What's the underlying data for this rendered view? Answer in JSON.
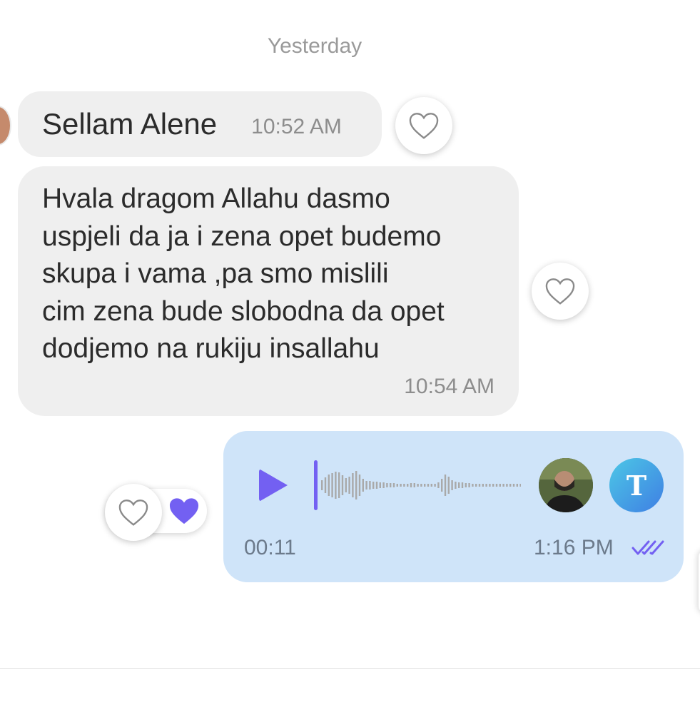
{
  "chat": {
    "date_separator": "Yesterday",
    "messages": [
      {
        "direction": "incoming",
        "text": "Sellam Alene",
        "time": "10:52 AM",
        "liked": false
      },
      {
        "direction": "incoming",
        "lines": [
          "Hvala dragom Allahu dasmo",
          "uspjeli da ja i zena opet budemo",
          "skupa i vama ,pa smo mislili",
          "cim zena bude slobodna da opet",
          "dodjemo na rukiju insallahu"
        ],
        "time": "10:54 AM",
        "liked": false
      }
    ],
    "voice_message": {
      "direction": "outgoing",
      "duration": "00:11",
      "time": "1:16 PM",
      "status": "read",
      "badge_letter": "T",
      "reaction": "heart"
    }
  },
  "colors": {
    "incoming_bubble": "#efefef",
    "outgoing_bubble": "#cfe4f9",
    "accent": "#7360f2"
  },
  "icons": {
    "like": "heart-outline-icon",
    "reaction": "heart-filled-icon",
    "play": "play-icon",
    "read": "double-check-icon"
  }
}
